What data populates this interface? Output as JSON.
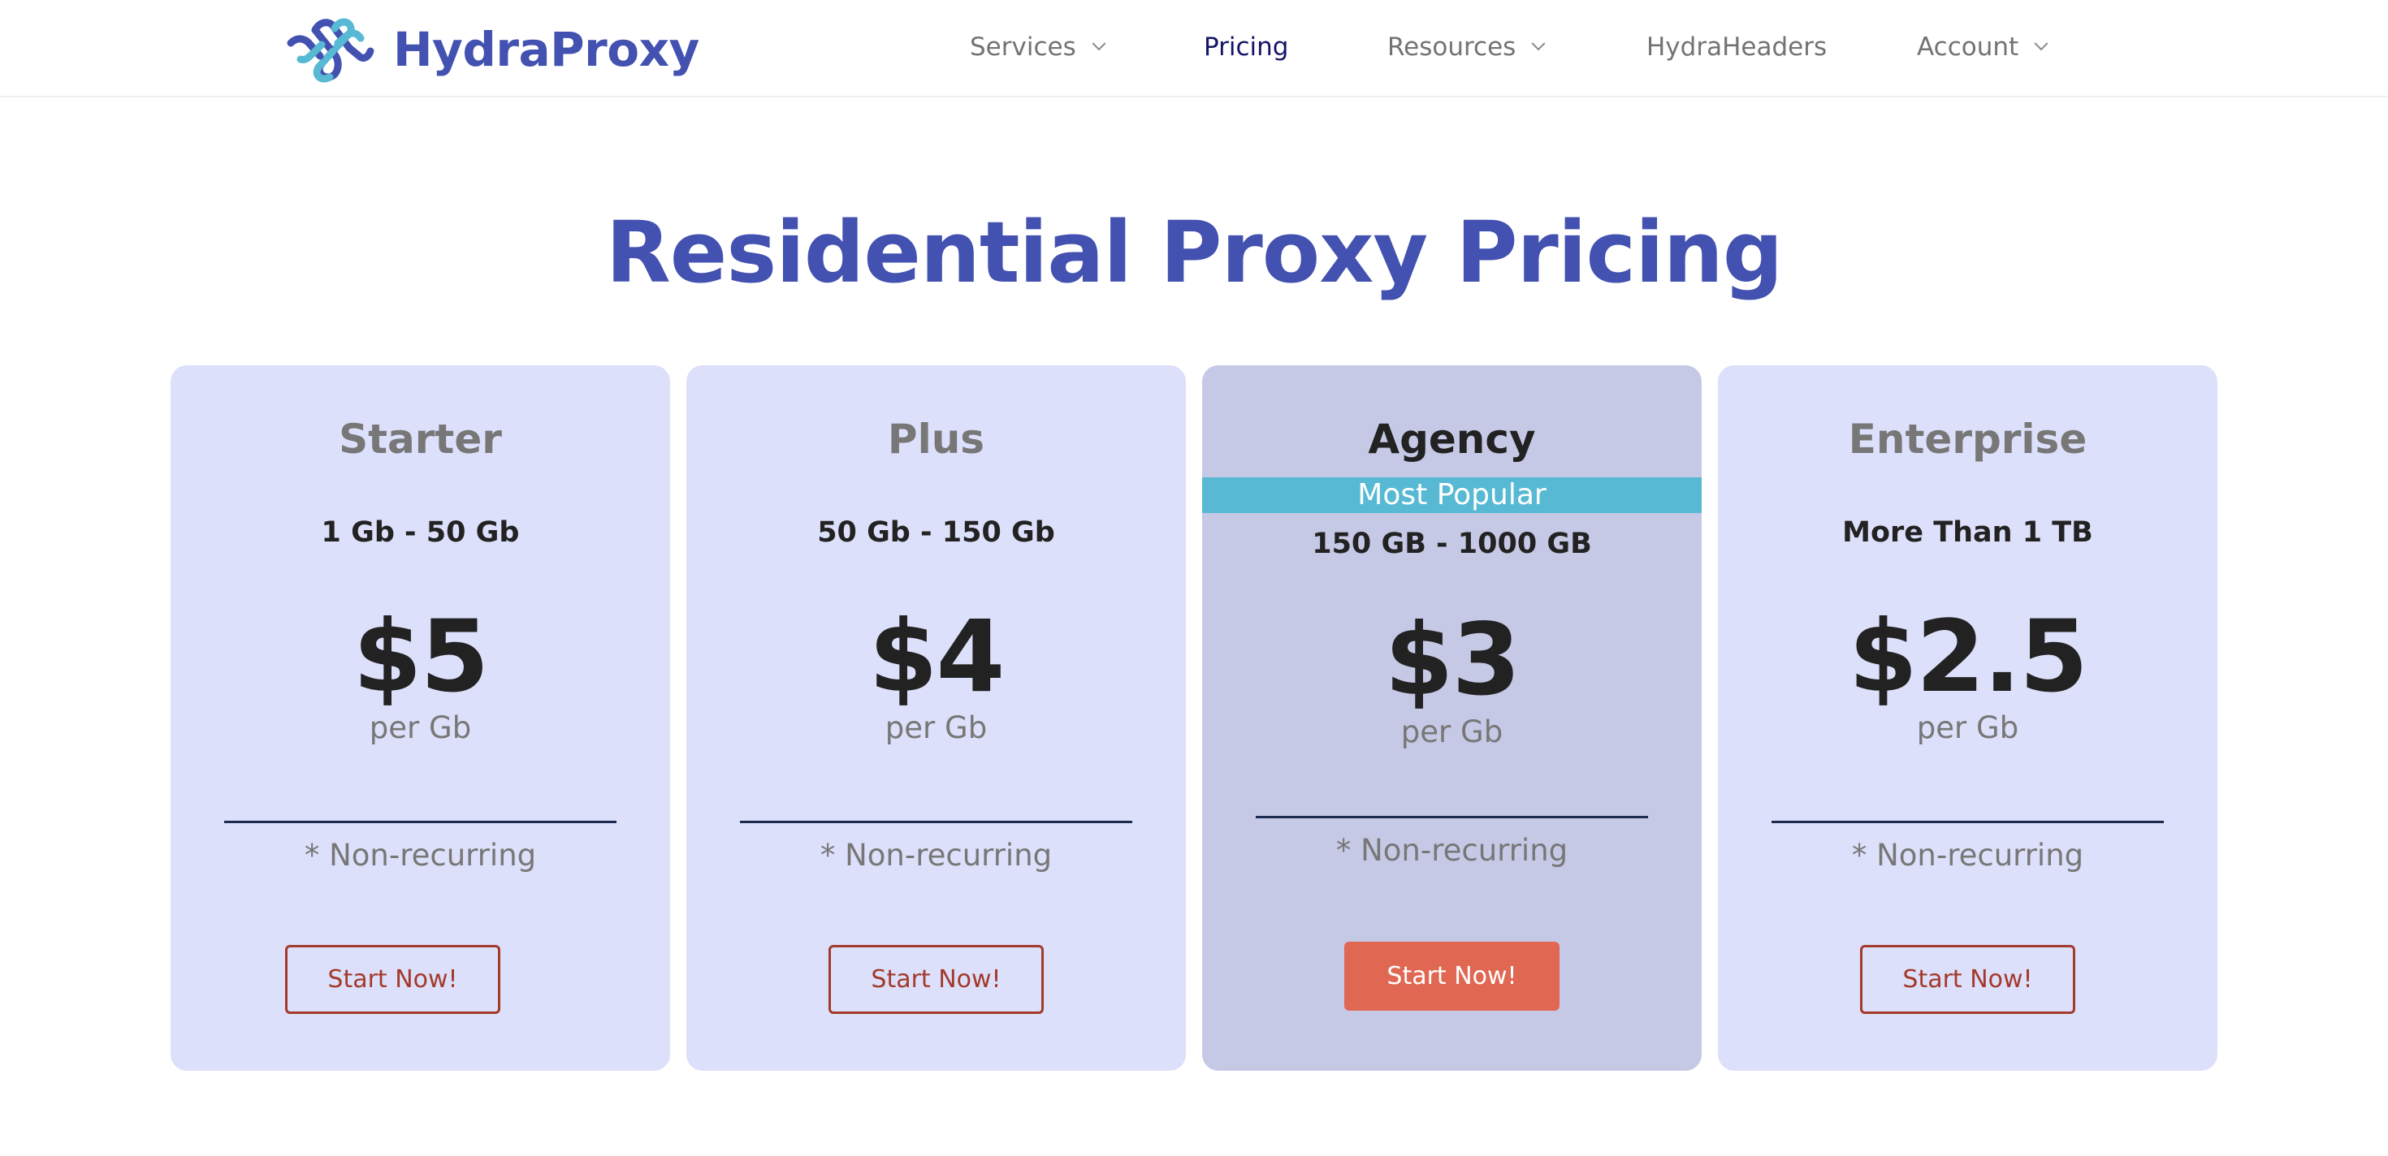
{
  "header": {
    "brand": "HydraProxy",
    "brand_color": "#4351b0",
    "nav": [
      {
        "label": "Services",
        "has_dropdown": true,
        "active": false
      },
      {
        "label": "Pricing",
        "has_dropdown": false,
        "active": true
      },
      {
        "label": "Resources",
        "has_dropdown": true,
        "active": false
      },
      {
        "label": "HydraHeaders",
        "has_dropdown": false,
        "active": false
      },
      {
        "label": "Account",
        "has_dropdown": true,
        "active": false
      }
    ]
  },
  "main": {
    "title": "Residential Proxy Pricing",
    "plans": [
      {
        "name": "Starter",
        "range": "1 Gb - 50 Gb",
        "price": "$5",
        "unit": "per Gb",
        "note": "* Non-recurring",
        "cta": "Start Now!",
        "featured": false
      },
      {
        "name": "Plus",
        "range": "50 Gb - 150 Gb",
        "price": "$4",
        "unit": "per Gb",
        "note": "* Non-recurring",
        "cta": "Start Now!",
        "featured": false
      },
      {
        "name": "Agency",
        "badge": "Most Popular",
        "range": "150 GB - 1000 GB",
        "price": "$3",
        "unit": "per Gb",
        "note": "* Non-recurring",
        "cta": "Start Now!",
        "featured": true
      },
      {
        "name": "Enterprise",
        "range": "More Than 1 TB",
        "price": "$2.5",
        "unit": "per Gb",
        "note": "* Non-recurring",
        "cta": "Start Now!",
        "featured": false
      }
    ]
  },
  "colors": {
    "card_bg": "#dde0fa",
    "featured_card_bg": "#c6c9e6",
    "badge_bg": "#57b9d3",
    "cta_outline": "#a33a2b",
    "cta_filled": "#e06752"
  }
}
